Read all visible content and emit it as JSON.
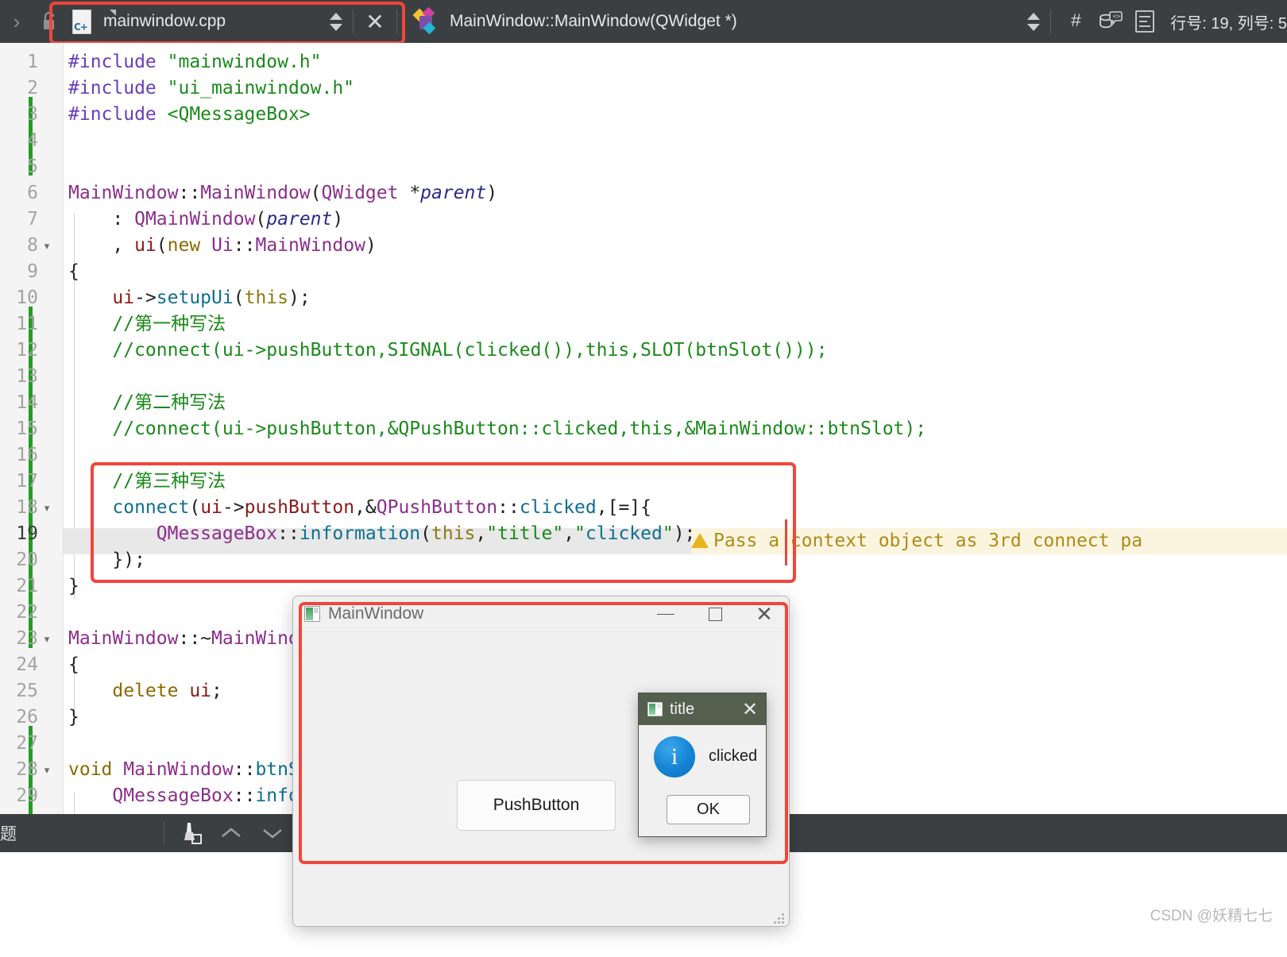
{
  "toolbar": {
    "nav_chevron": "›",
    "lock_icon": "unlocked-padlock-icon",
    "file_name": "mainwindow.cpp",
    "file_icon_label": "C+",
    "close_label": "✕",
    "function_name": "MainWindow::MainWindow(QWidget *)",
    "hash_label": "#",
    "line_info": "行号: 19, 列号: 5"
  },
  "editor": {
    "lines": [
      {
        "n": "1",
        "change": false,
        "fold": "",
        "text": "#include \"mainwindow.h\""
      },
      {
        "n": "2",
        "change": false,
        "fold": "",
        "text": "#include \"ui_mainwindow.h\""
      },
      {
        "n": "3",
        "change": true,
        "fold": "",
        "text": "#include <QMessageBox>"
      },
      {
        "n": "4",
        "change": true,
        "fold": "",
        "text": ""
      },
      {
        "n": "5",
        "change": true,
        "fold": "",
        "text": ""
      },
      {
        "n": "6",
        "change": false,
        "fold": "",
        "text": "MainWindow::MainWindow(QWidget *parent)"
      },
      {
        "n": "7",
        "change": false,
        "fold": "",
        "text": "    : QMainWindow(parent)"
      },
      {
        "n": "8",
        "change": false,
        "fold": "▾",
        "text": "    , ui(new Ui::MainWindow)"
      },
      {
        "n": "9",
        "change": false,
        "fold": "",
        "text": "{"
      },
      {
        "n": "10",
        "change": false,
        "fold": "",
        "text": "    ui->setupUi(this);"
      },
      {
        "n": "11",
        "change": true,
        "fold": "",
        "text": "    //第一种写法"
      },
      {
        "n": "12",
        "change": true,
        "fold": "",
        "text": "    //connect(ui->pushButton,SIGNAL(clicked()),this,SLOT(btnSlot()));"
      },
      {
        "n": "13",
        "change": true,
        "fold": "",
        "text": ""
      },
      {
        "n": "14",
        "change": true,
        "fold": "",
        "text": "    //第二种写法"
      },
      {
        "n": "15",
        "change": true,
        "fold": "",
        "text": "    //connect(ui->pushButton,&QPushButton::clicked,this,&MainWindow::btnSlot);"
      },
      {
        "n": "16",
        "change": true,
        "fold": "",
        "text": ""
      },
      {
        "n": "17",
        "change": true,
        "fold": "",
        "text": "    //第三种写法"
      },
      {
        "n": "18",
        "change": true,
        "fold": "▾",
        "text": "    connect(ui->pushButton,&QPushButton::clicked,[=]{"
      },
      {
        "n": "19",
        "change": true,
        "fold": "",
        "text": "        QMessageBox::information(this,\"title\",\"clicked\");",
        "current": true
      },
      {
        "n": "20",
        "change": true,
        "fold": "",
        "text": "    });"
      },
      {
        "n": "21",
        "change": true,
        "fold": "",
        "text": "}"
      },
      {
        "n": "22",
        "change": false,
        "fold": "",
        "text": ""
      },
      {
        "n": "23",
        "change": false,
        "fold": "▾",
        "text": "MainWindow::~MainWindow()"
      },
      {
        "n": "24",
        "change": false,
        "fold": "",
        "text": "{"
      },
      {
        "n": "25",
        "change": false,
        "fold": "",
        "text": "    delete ui;"
      },
      {
        "n": "26",
        "change": false,
        "fold": "",
        "text": "}"
      },
      {
        "n": "27",
        "change": true,
        "fold": "",
        "text": ""
      },
      {
        "n": "28",
        "change": true,
        "fold": "▾",
        "text": "void MainWindow::btnSlot()"
      },
      {
        "n": "29",
        "change": true,
        "fold": "",
        "text": "    QMessageBox::information(...)"
      }
    ],
    "warning": {
      "text": "Pass a context object as 3rd connect pa",
      "icon": "warning-triangle-icon",
      "color": "#b08a18",
      "background": "#fbf5df"
    },
    "current_line": "19"
  },
  "bottom_bar": {
    "label": "题",
    "clean_icon": "broom-icon",
    "prev_icon": "chevron-up-icon",
    "next_icon": "chevron-down-icon",
    "warning_icon": "warning-triangle-icon"
  },
  "qt_main_window": {
    "title": "MainWindow",
    "minimize_label": "—",
    "maximize_label": "☐",
    "close_label": "✕",
    "push_button_label": "PushButton"
  },
  "qt_message_box": {
    "title": "title",
    "close_label": "✕",
    "icon": "information-icon",
    "icon_glyph": "i",
    "message": "clicked",
    "ok_label": "OK"
  },
  "annotations": {
    "boxes": [
      "file-selector-highlight",
      "code-block-highlight",
      "main-window-highlight"
    ],
    "color": "#f0463c"
  },
  "watermark": "CSDN @妖精七七"
}
